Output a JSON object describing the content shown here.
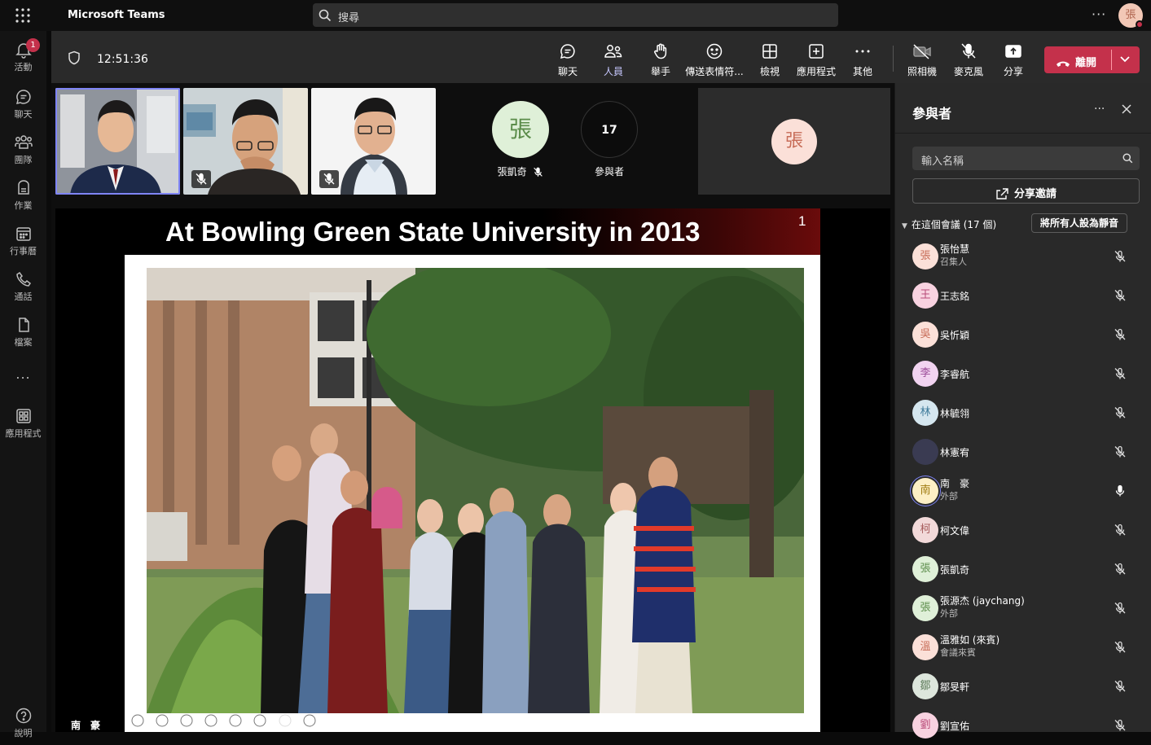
{
  "app": {
    "title": "Microsoft Teams"
  },
  "search": {
    "placeholder": "搜尋"
  },
  "user": {
    "initial": "張"
  },
  "rail": [
    {
      "label": "活動",
      "badge": "1",
      "icon": "bell-icon"
    },
    {
      "label": "聊天",
      "icon": "chat-icon"
    },
    {
      "label": "團隊",
      "icon": "teams-icon"
    },
    {
      "label": "作業",
      "icon": "assignments-icon"
    },
    {
      "label": "行事曆",
      "icon": "calendar-icon"
    },
    {
      "label": "通話",
      "icon": "phone-icon"
    },
    {
      "label": "檔案",
      "icon": "file-icon"
    },
    {
      "label": "...",
      "icon": "more-icon"
    },
    {
      "label": "應用程式",
      "icon": "apps-icon"
    },
    {
      "label": "說明",
      "icon": "help-icon"
    }
  ],
  "meeting": {
    "time": "12:51:36",
    "controls": {
      "chat": "聊天",
      "people": "人員",
      "raise_hand": "舉手",
      "reactions": "傳送表情符...",
      "view": "檢視",
      "apps": "應用程式",
      "more": "其他",
      "camera": "照相機",
      "mic": "麥克風",
      "share": "分享",
      "leave": "離開"
    }
  },
  "gallery": {
    "avatar_tile": {
      "initial": "張",
      "name": "張凱奇"
    },
    "count_tile": {
      "count": "17",
      "label": "參與者"
    },
    "gray_tile": {
      "initial": "張"
    }
  },
  "slide": {
    "title": "At Bowling Green State University in 2013",
    "page_number": "1",
    "presenter": "南　豪"
  },
  "panel": {
    "title": "參與者",
    "search_placeholder": "輸入名稱",
    "share_label": "分享邀請",
    "section_label": "在這個會議 (17 個)",
    "mute_all": "將所有人設為靜音",
    "participants": [
      {
        "initial": "張",
        "name": "張怡慧",
        "sub": "召集人",
        "muted": true,
        "color": "#fbe0d8",
        "fg": "#c76c57"
      },
      {
        "initial": "王",
        "name": "王志銘",
        "sub": "",
        "muted": true,
        "color": "#f8d2e0",
        "fg": "#b84a77"
      },
      {
        "initial": "吳",
        "name": "吳忻穎",
        "sub": "",
        "muted": true,
        "color": "#fbe0d8",
        "fg": "#c76c57"
      },
      {
        "initial": "李",
        "name": "李睿航",
        "sub": "",
        "muted": true,
        "color": "#f1d3f0",
        "fg": "#9a4a97"
      },
      {
        "initial": "林",
        "name": "林毓翎",
        "sub": "",
        "muted": true,
        "color": "#d5e6ef",
        "fg": "#3f7b9b"
      },
      {
        "initial": "",
        "name": "林憲宥",
        "sub": "",
        "muted": true,
        "color": "#3a3b52",
        "fg": "#d9c26a"
      },
      {
        "initial": "南",
        "name": "南　豪",
        "sub": "外部",
        "muted": false,
        "color": "#fdefc5",
        "fg": "#a07b10"
      },
      {
        "initial": "柯",
        "name": "柯文偉",
        "sub": "",
        "muted": true,
        "color": "#f2d9d9",
        "fg": "#a65c5c"
      },
      {
        "initial": "張",
        "name": "張凱奇",
        "sub": "",
        "muted": true,
        "color": "#dff0d8",
        "fg": "#5b8c4a"
      },
      {
        "initial": "張",
        "name": "張源杰 (jaychang)",
        "sub": "外部",
        "muted": true,
        "color": "#dff0d8",
        "fg": "#5b8c4a"
      },
      {
        "initial": "溫",
        "name": "溫雅如 (來賓)",
        "sub": "會議來賓",
        "muted": true,
        "color": "#fbe0d8",
        "fg": "#c76c57"
      },
      {
        "initial": "鄒",
        "name": "鄒旻軒",
        "sub": "",
        "muted": true,
        "color": "#dde6dc",
        "fg": "#5c7a59"
      },
      {
        "initial": "劉",
        "name": "劉宣佑",
        "sub": "",
        "muted": true,
        "color": "#f8d2e0",
        "fg": "#b84a77"
      }
    ]
  },
  "colors": {
    "accent": "#7f85f5",
    "leave": "#c4314b",
    "panel_bg": "#292929",
    "toolbar_bg": "#2a2a2a"
  }
}
